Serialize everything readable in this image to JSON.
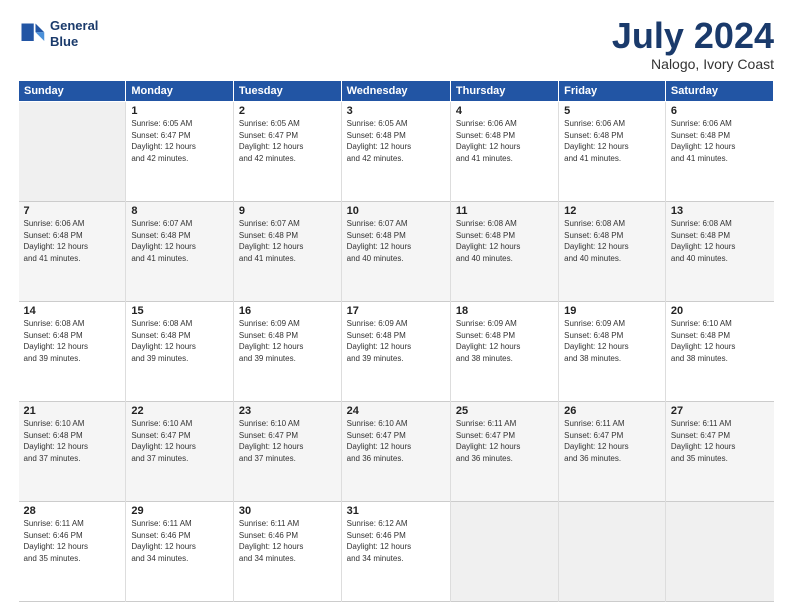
{
  "header": {
    "logo_line1": "General",
    "logo_line2": "Blue",
    "month": "July 2024",
    "location": "Nalogo, Ivory Coast"
  },
  "days_of_week": [
    "Sunday",
    "Monday",
    "Tuesday",
    "Wednesday",
    "Thursday",
    "Friday",
    "Saturday"
  ],
  "weeks": [
    [
      {
        "day": "",
        "detail": ""
      },
      {
        "day": "1",
        "detail": "Sunrise: 6:05 AM\nSunset: 6:47 PM\nDaylight: 12 hours\nand 42 minutes."
      },
      {
        "day": "2",
        "detail": "Sunrise: 6:05 AM\nSunset: 6:47 PM\nDaylight: 12 hours\nand 42 minutes."
      },
      {
        "day": "3",
        "detail": "Sunrise: 6:05 AM\nSunset: 6:48 PM\nDaylight: 12 hours\nand 42 minutes."
      },
      {
        "day": "4",
        "detail": "Sunrise: 6:06 AM\nSunset: 6:48 PM\nDaylight: 12 hours\nand 41 minutes."
      },
      {
        "day": "5",
        "detail": "Sunrise: 6:06 AM\nSunset: 6:48 PM\nDaylight: 12 hours\nand 41 minutes."
      },
      {
        "day": "6",
        "detail": "Sunrise: 6:06 AM\nSunset: 6:48 PM\nDaylight: 12 hours\nand 41 minutes."
      }
    ],
    [
      {
        "day": "7",
        "detail": "Sunrise: 6:06 AM\nSunset: 6:48 PM\nDaylight: 12 hours\nand 41 minutes."
      },
      {
        "day": "8",
        "detail": "Sunrise: 6:07 AM\nSunset: 6:48 PM\nDaylight: 12 hours\nand 41 minutes."
      },
      {
        "day": "9",
        "detail": "Sunrise: 6:07 AM\nSunset: 6:48 PM\nDaylight: 12 hours\nand 41 minutes."
      },
      {
        "day": "10",
        "detail": "Sunrise: 6:07 AM\nSunset: 6:48 PM\nDaylight: 12 hours\nand 40 minutes."
      },
      {
        "day": "11",
        "detail": "Sunrise: 6:08 AM\nSunset: 6:48 PM\nDaylight: 12 hours\nand 40 minutes."
      },
      {
        "day": "12",
        "detail": "Sunrise: 6:08 AM\nSunset: 6:48 PM\nDaylight: 12 hours\nand 40 minutes."
      },
      {
        "day": "13",
        "detail": "Sunrise: 6:08 AM\nSunset: 6:48 PM\nDaylight: 12 hours\nand 40 minutes."
      }
    ],
    [
      {
        "day": "14",
        "detail": "Sunrise: 6:08 AM\nSunset: 6:48 PM\nDaylight: 12 hours\nand 39 minutes."
      },
      {
        "day": "15",
        "detail": "Sunrise: 6:08 AM\nSunset: 6:48 PM\nDaylight: 12 hours\nand 39 minutes."
      },
      {
        "day": "16",
        "detail": "Sunrise: 6:09 AM\nSunset: 6:48 PM\nDaylight: 12 hours\nand 39 minutes."
      },
      {
        "day": "17",
        "detail": "Sunrise: 6:09 AM\nSunset: 6:48 PM\nDaylight: 12 hours\nand 39 minutes."
      },
      {
        "day": "18",
        "detail": "Sunrise: 6:09 AM\nSunset: 6:48 PM\nDaylight: 12 hours\nand 38 minutes."
      },
      {
        "day": "19",
        "detail": "Sunrise: 6:09 AM\nSunset: 6:48 PM\nDaylight: 12 hours\nand 38 minutes."
      },
      {
        "day": "20",
        "detail": "Sunrise: 6:10 AM\nSunset: 6:48 PM\nDaylight: 12 hours\nand 38 minutes."
      }
    ],
    [
      {
        "day": "21",
        "detail": "Sunrise: 6:10 AM\nSunset: 6:48 PM\nDaylight: 12 hours\nand 37 minutes."
      },
      {
        "day": "22",
        "detail": "Sunrise: 6:10 AM\nSunset: 6:47 PM\nDaylight: 12 hours\nand 37 minutes."
      },
      {
        "day": "23",
        "detail": "Sunrise: 6:10 AM\nSunset: 6:47 PM\nDaylight: 12 hours\nand 37 minutes."
      },
      {
        "day": "24",
        "detail": "Sunrise: 6:10 AM\nSunset: 6:47 PM\nDaylight: 12 hours\nand 36 minutes."
      },
      {
        "day": "25",
        "detail": "Sunrise: 6:11 AM\nSunset: 6:47 PM\nDaylight: 12 hours\nand 36 minutes."
      },
      {
        "day": "26",
        "detail": "Sunrise: 6:11 AM\nSunset: 6:47 PM\nDaylight: 12 hours\nand 36 minutes."
      },
      {
        "day": "27",
        "detail": "Sunrise: 6:11 AM\nSunset: 6:47 PM\nDaylight: 12 hours\nand 35 minutes."
      }
    ],
    [
      {
        "day": "28",
        "detail": "Sunrise: 6:11 AM\nSunset: 6:46 PM\nDaylight: 12 hours\nand 35 minutes."
      },
      {
        "day": "29",
        "detail": "Sunrise: 6:11 AM\nSunset: 6:46 PM\nDaylight: 12 hours\nand 34 minutes."
      },
      {
        "day": "30",
        "detail": "Sunrise: 6:11 AM\nSunset: 6:46 PM\nDaylight: 12 hours\nand 34 minutes."
      },
      {
        "day": "31",
        "detail": "Sunrise: 6:12 AM\nSunset: 6:46 PM\nDaylight: 12 hours\nand 34 minutes."
      },
      {
        "day": "",
        "detail": ""
      },
      {
        "day": "",
        "detail": ""
      },
      {
        "day": "",
        "detail": ""
      }
    ]
  ]
}
